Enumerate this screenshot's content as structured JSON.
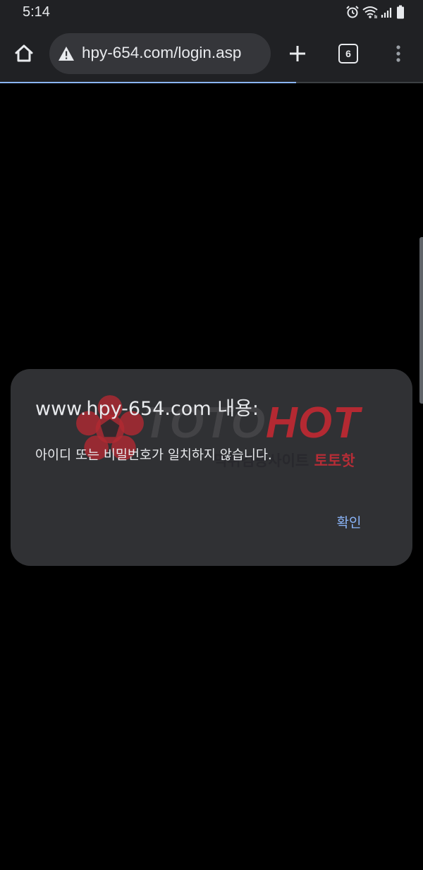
{
  "status_bar": {
    "time": "5:14",
    "icons": [
      "alarm-icon",
      "wifi-icon",
      "signal-icon",
      "battery-icon"
    ]
  },
  "browser": {
    "url": "hpy-654.com/login.asp",
    "tab_count": "6",
    "load_progress": 0.7,
    "icons": [
      "home-icon",
      "warning-icon",
      "plus-icon",
      "tabs-icon",
      "more-vert-icon"
    ]
  },
  "dialog": {
    "title": "www.hpy-654.com 내용:",
    "message": "아이디 또는 비밀번호가 일치하지 않습니다.",
    "ok_label": "확인"
  },
  "watermark": {
    "brand_a": "TOTO",
    "brand_b": "HOT",
    "sub_a": "먹튀검증사이트",
    "sub_b": "토토핫"
  },
  "colors": {
    "toolbar_bg": "#202124",
    "omnibox_bg": "#35363a",
    "dialog_bg": "#303134",
    "accent": "#8ab4f8",
    "watermark_red": "#d22832"
  }
}
